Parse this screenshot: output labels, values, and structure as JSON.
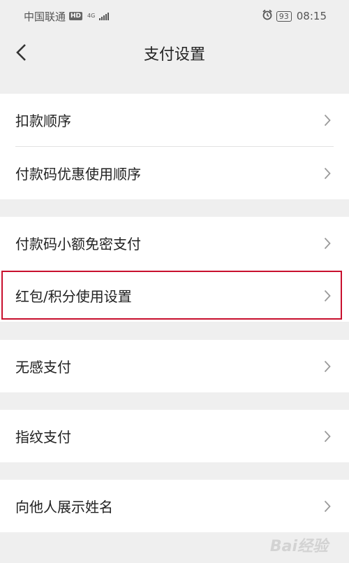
{
  "status_bar": {
    "carrier": "中国联通",
    "hd": "HD",
    "network": "4G",
    "battery": "93",
    "time": "08:15"
  },
  "header": {
    "title": "支付设置",
    "back_icon": "chevron-left-icon"
  },
  "groups": [
    {
      "items": [
        {
          "label": "扣款顺序"
        },
        {
          "label": "付款码优惠使用顺序"
        }
      ]
    },
    {
      "items": [
        {
          "label": "付款码小额免密支付"
        },
        {
          "label": "红包/积分使用设置"
        }
      ]
    },
    {
      "items": [
        {
          "label": "无感支付"
        }
      ]
    },
    {
      "items": [
        {
          "label": "指纹支付"
        }
      ]
    },
    {
      "items": [
        {
          "label": "向他人展示姓名"
        }
      ]
    }
  ],
  "watermark": "Bai经验",
  "colors": {
    "highlight": "#c8102e",
    "background": "#efefef"
  }
}
